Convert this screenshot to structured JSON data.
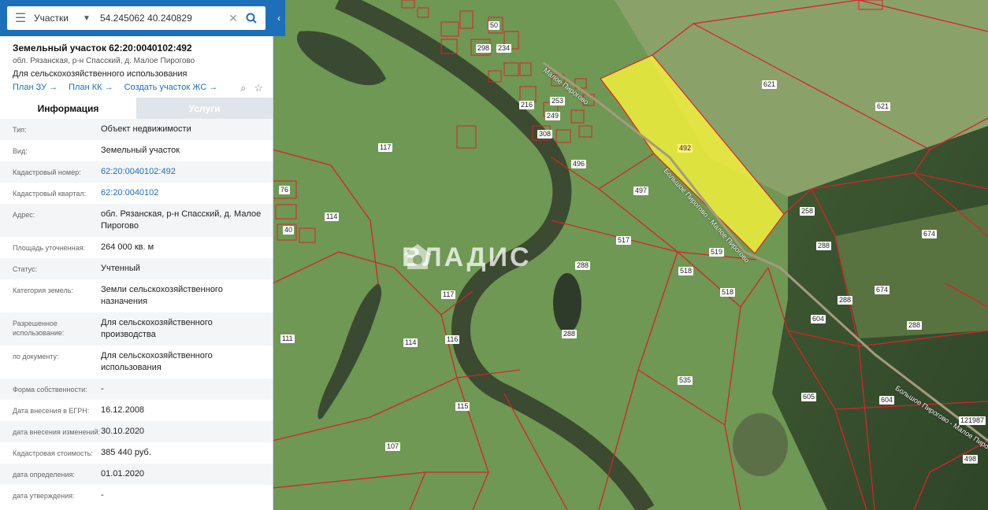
{
  "search": {
    "mode": "Участки",
    "query": "54.245062 40.240829"
  },
  "object": {
    "title": "Земельный участок 62:20:0040102:492",
    "address": "обл. Рязанская, р-н Спасский, д. Малое Пирогово",
    "use": "Для сельскохозяйственного использования"
  },
  "links": [
    "План ЗУ →",
    "План КК →",
    "Создать участок ЖС →"
  ],
  "tabs": [
    "Информация",
    "Услуги"
  ],
  "info": [
    {
      "k": "Тип:",
      "v": "Объект недвижимости"
    },
    {
      "k": "Вид:",
      "v": "Земельный участок"
    },
    {
      "k": "Кадастровый номер:",
      "v": "62:20:0040102:492",
      "link": true
    },
    {
      "k": "Кадастровый квартал:",
      "v": "62:20:0040102",
      "link": true
    },
    {
      "k": "Адрес:",
      "v": "обл. Рязанская, р-н Спасский, д. Малое Пирогово"
    },
    {
      "k": "Площадь уточненная:",
      "v": "264 000 кв. м"
    },
    {
      "k": "Статус:",
      "v": "Учтенный"
    },
    {
      "k": "Категория земель:",
      "v": "Земли сельскохозяйственного назначения"
    },
    {
      "k": "Разрешенное использование:",
      "v": "Для сельскохозяйственного производства"
    },
    {
      "k": "по документу:",
      "v": "Для сельскохозяйственного использования"
    },
    {
      "k": "Форма собственности:",
      "v": "-"
    },
    {
      "k": "Дата внесения в ЕГРН:",
      "v": "16.12.2008"
    },
    {
      "k": "дата внесения изменений:",
      "v": "30.10.2020"
    },
    {
      "k": "Кадастровая стоимость:",
      "v": "385 440 руб."
    },
    {
      "k": "дата определения:",
      "v": "01.01.2020"
    },
    {
      "k": "дата утверждения:",
      "v": "-"
    }
  ],
  "watermark": "ВЛАДИС",
  "colors": {
    "accent": "#1d6fba",
    "highlight": "#f2ee3c",
    "parcel_border": "#d8232a"
  },
  "map_labels": [
    "117",
    "114",
    "76",
    "111",
    "114",
    "117",
    "116",
    "115",
    "107",
    "288",
    "288",
    "517",
    "518",
    "519",
    "518",
    "535",
    "497",
    "492",
    "621",
    "621",
    "674",
    "288",
    "288",
    "674",
    "604",
    "288",
    "605",
    "604",
    "498",
    "121987",
    "308",
    "249",
    "216",
    "253",
    "234",
    "50",
    "258",
    "496",
    "40",
    "298"
  ],
  "road_labels": [
    "Малое Пирогово",
    "Большое Пирогово - Малое Пирогово",
    "Большое Пирогово - Малое Пирогово"
  ]
}
